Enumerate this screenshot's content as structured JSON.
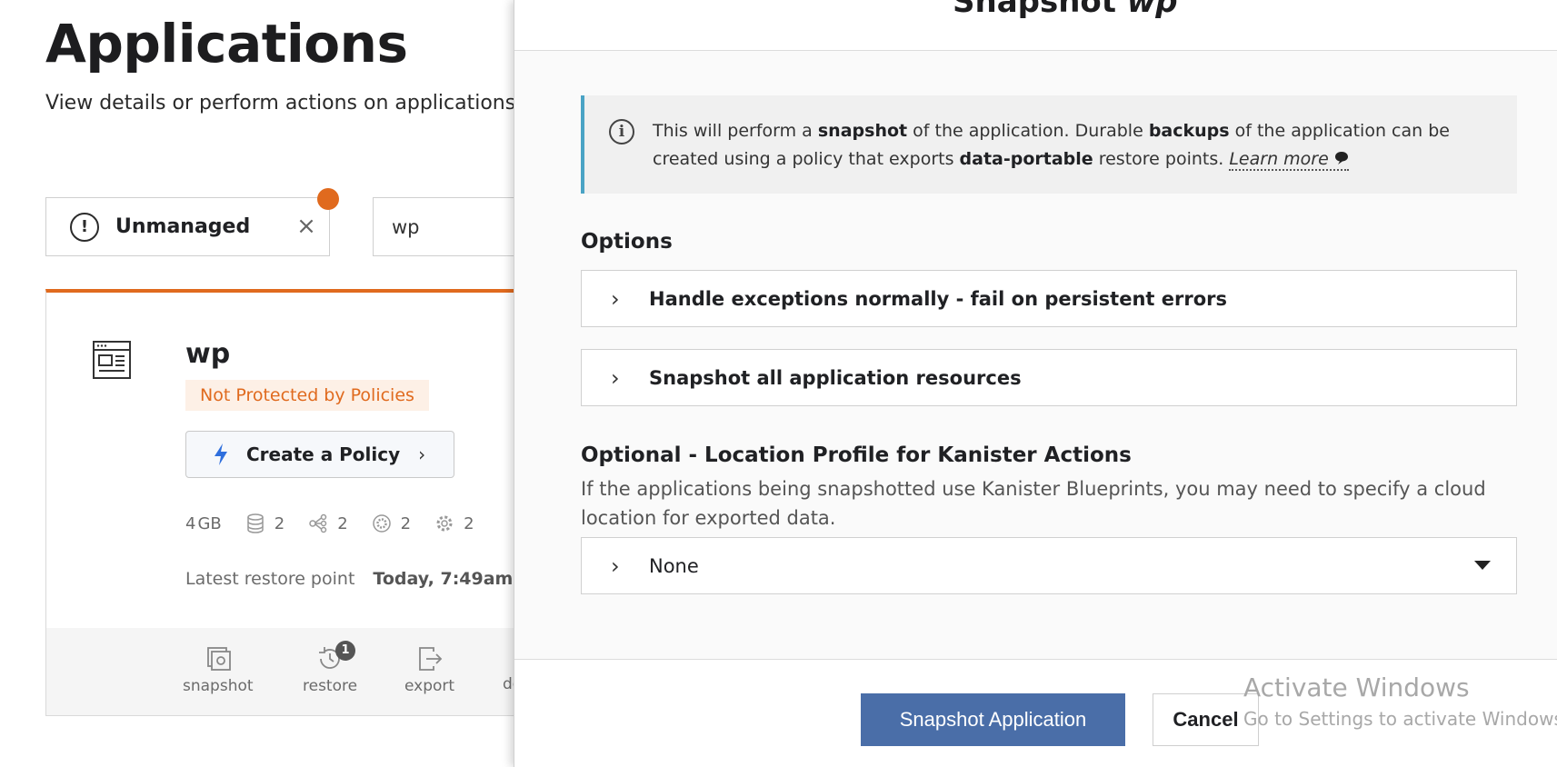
{
  "page": {
    "title": "Applications",
    "subtitle": "View details or perform actions on applications"
  },
  "filter": {
    "chip_label": "Unmanaged",
    "chip_icon": "exclamation-circle-icon",
    "close_icon": "close-icon",
    "search_value": "wp",
    "dot_color": "#e06a1e"
  },
  "app_card": {
    "name": "wp",
    "badge": "Not Protected by Policies",
    "policy_button": "Create a Policy",
    "stats": {
      "size_value": "4",
      "size_unit": "GB",
      "volumes": "2",
      "workloads": "2",
      "services": "2",
      "configs": "2"
    },
    "restore_label": "Latest restore point",
    "restore_value": "Today, 7:49am",
    "actions": {
      "snapshot": "snapshot",
      "restore": "restore",
      "restore_badge": "1",
      "export": "export",
      "partial": "de"
    }
  },
  "panel": {
    "title_prefix": "Snapshot",
    "title_app": "wp",
    "info": {
      "t1": "This will perform a ",
      "b1": "snapshot",
      "t2": " of the application. Durable ",
      "b2": "backups",
      "t3": " of the application can be created using a policy that exports ",
      "b3": "data-portable",
      "t4": " restore points. ",
      "learn_more": "Learn more"
    },
    "options_label": "Options",
    "option1": "Handle exceptions normally - fail on persistent errors",
    "option2": "Snapshot all application resources",
    "location_label": "Optional - Location Profile for Kanister Actions",
    "location_desc": "If the applications being snapshotted use Kanister Blueprints, you may need to specify a cloud location for exported data.",
    "location_value": "None",
    "primary_button": "Snapshot Application",
    "cancel_button": "Cancel"
  },
  "watermark": {
    "line1": "Activate Windows",
    "line2": "Go to Settings to activate Windows."
  },
  "colors": {
    "accent_orange": "#e06a1e",
    "primary_blue": "#4a6ea8",
    "info_border": "#4aa3c5"
  }
}
